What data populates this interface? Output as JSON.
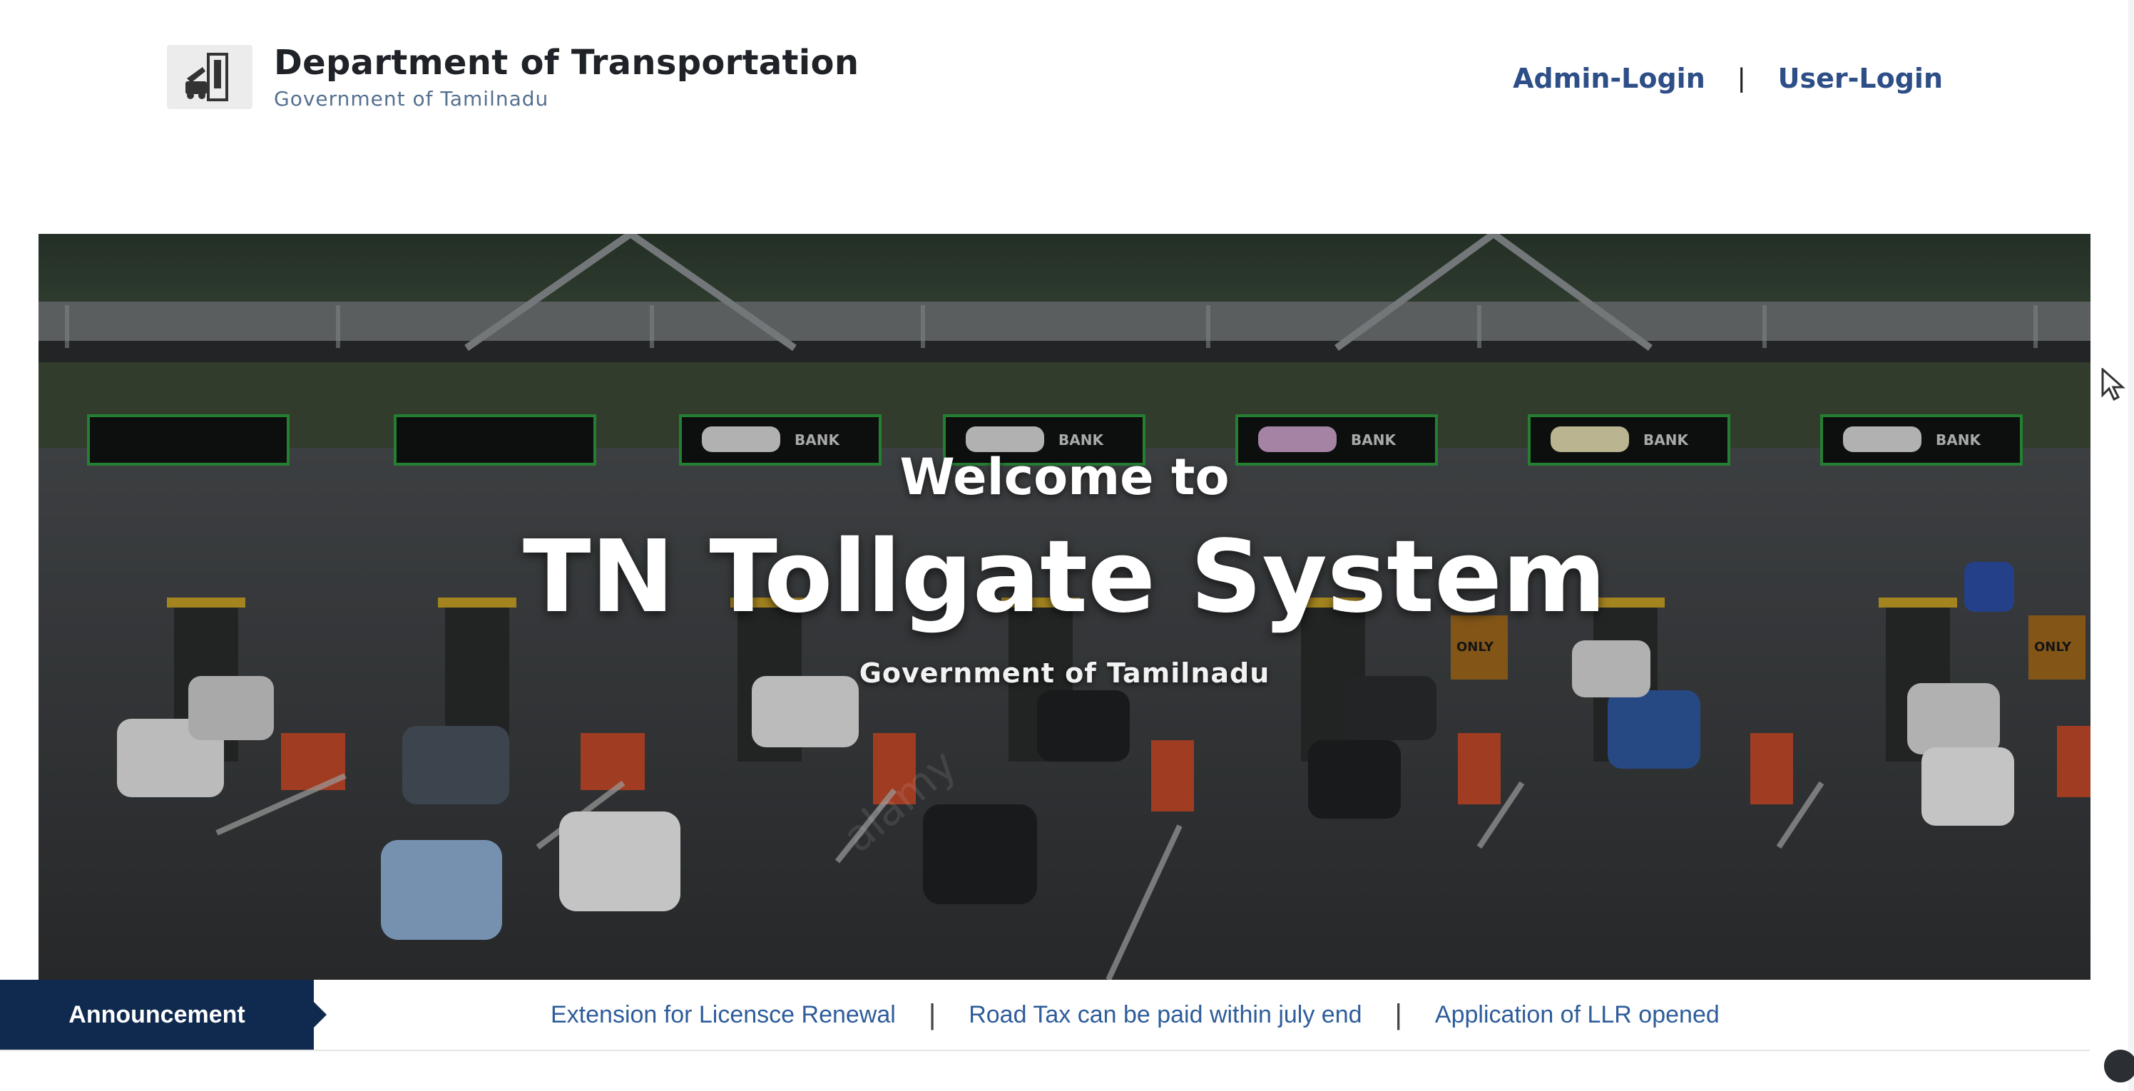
{
  "header": {
    "logo_icon": "transport-building-icon",
    "title": "Department of Transportation",
    "subtitle": "Government of Tamilnadu",
    "nav": {
      "admin_login": "Admin-Login",
      "separator": "|",
      "user_login": "User-Login"
    }
  },
  "hero": {
    "welcome": "Welcome to",
    "title": "TN Tollgate System",
    "subtitle": "Government of Tamilnadu",
    "sign_bank": "BANK",
    "sign_only": "ONLY"
  },
  "announcement": {
    "label": "Announcement",
    "items": [
      "Extension for Licensce Renewal",
      "Road Tax can be paid within july end",
      "Application of LLR opened"
    ],
    "separator": "|"
  },
  "colors": {
    "brand_navy": "#102a4f",
    "link_blue": "#2d4e86",
    "announcement_text": "#2e5d9a"
  }
}
